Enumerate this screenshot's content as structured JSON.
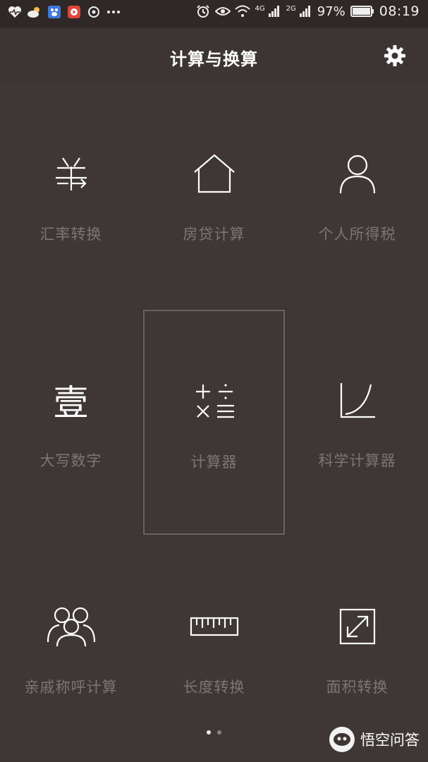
{
  "status_bar": {
    "time": "08:19",
    "battery_percent": "97%",
    "network_4g": "4G",
    "network_2g": "2G",
    "left_icons": [
      "health-icon",
      "weather-icon",
      "baidu-icon",
      "video-icon",
      "netease-icon",
      "more-icon"
    ],
    "right_icons": [
      "alarm-icon",
      "eye-icon",
      "wifi-icon",
      "signal-icon",
      "battery-icon"
    ]
  },
  "header": {
    "title": "计算与换算",
    "settings_icon": "gear-icon"
  },
  "tools": [
    {
      "label": "汇率转换",
      "icon": "currency-icon"
    },
    {
      "label": "房贷计算",
      "icon": "house-icon"
    },
    {
      "label": "个人所得税",
      "icon": "person-icon"
    },
    {
      "label": "大写数字",
      "icon": "chinese-numeral-icon",
      "glyph": "壹"
    },
    {
      "label": "计算器",
      "icon": "calculator-icon"
    },
    {
      "label": "科学计算器",
      "icon": "curve-graph-icon"
    },
    {
      "label": "亲戚称呼计算",
      "icon": "family-icon"
    },
    {
      "label": "长度转换",
      "icon": "ruler-icon"
    },
    {
      "label": "面积转换",
      "icon": "resize-icon"
    }
  ],
  "selected_tool": "计算器",
  "pager": {
    "pages": 2,
    "current": 1
  },
  "watermark": {
    "text": "悟空问答"
  },
  "colors": {
    "background": "#3d3534",
    "statusbar": "#2f2827",
    "label": "#7d7473",
    "icon": "#ffffff"
  }
}
